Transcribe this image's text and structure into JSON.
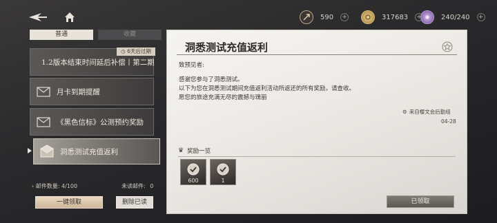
{
  "topbar": {
    "currencies": [
      {
        "icon": "stamina-icon",
        "value": "590",
        "plus": "+"
      },
      {
        "icon": "coin-icon",
        "value": "317683",
        "plus": "+"
      },
      {
        "icon": "energy-icon",
        "value": "240/240",
        "plus": "+"
      }
    ]
  },
  "tabs": {
    "normal": "普通",
    "favorites": "收藏"
  },
  "mail_list": [
    {
      "title": "1.2版本结束时间延后补偿丨第二期",
      "badge": "6天后过期"
    },
    {
      "title": "月卡到期提醒"
    },
    {
      "title": "《黑色信标》公测预约奖励"
    },
    {
      "title": "洞悉测试充值返利",
      "selected": true
    }
  ],
  "counts": {
    "mail_count_label": "邮件数量:",
    "mail_count_value": "4/100",
    "unread_label": "未读邮件:",
    "unread_value": "0"
  },
  "buttons": {
    "claim_all": "一键领取",
    "delete_read": "删除已读",
    "claimed": "已领取"
  },
  "mail": {
    "title": "洞悉测试充值返利",
    "greeting": "致预见者:",
    "lines": [
      "感谢您参与了洞悉测试。",
      "以下为您在洞悉测试期间充值返利活动所返还的所有奖励，请查收。",
      "愿您的旅途充满无尽的震撼与瑰丽"
    ],
    "sender": "来自樱文会后勤组",
    "date": "04-28",
    "rewards_label": "奖励一览",
    "rewards": [
      {
        "icon": "reward-icon",
        "qty": "600"
      },
      {
        "icon": "reward-icon",
        "qty": "1"
      }
    ]
  },
  "colors": {
    "panel_bg": "#f2f0ed",
    "accent_button": "#d9c4a6",
    "badge": "#d7cfc1"
  }
}
